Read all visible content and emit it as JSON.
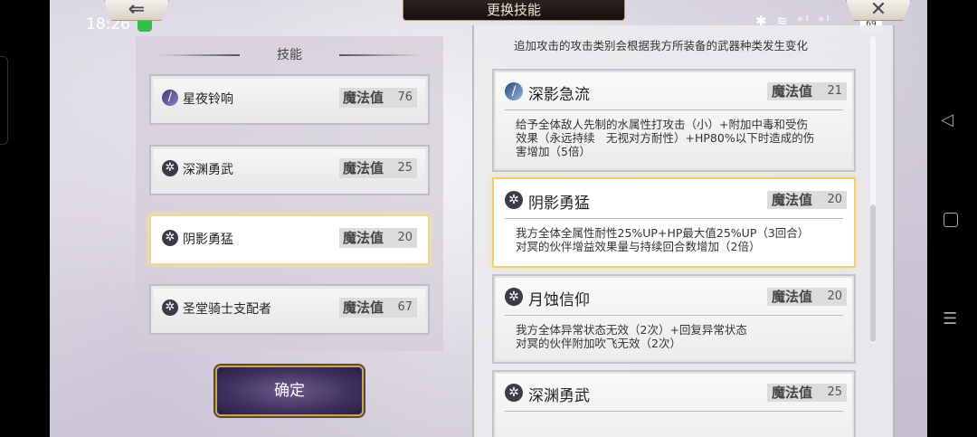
{
  "status": {
    "time": "18:26",
    "icons_right": "✱ ≋ ᵊᴵ ᵊᴵ",
    "battery": "69"
  },
  "title": "更换技能",
  "buttons": {
    "back": "⇐",
    "close": "✕",
    "confirm": "确定"
  },
  "left": {
    "header": "技能",
    "mp_label": "魔法值",
    "items": [
      {
        "name": "星夜铃响",
        "mp": "76",
        "icon": "magic-icon"
      },
      {
        "name": "深渊勇武",
        "mp": "25",
        "icon": "compass-icon"
      },
      {
        "name": "阴影勇猛",
        "mp": "20",
        "icon": "compass-icon"
      },
      {
        "name": "圣堂骑士支配者",
        "mp": "67",
        "icon": "compass-icon"
      }
    ]
  },
  "right": {
    "mp_label": "魔法值",
    "top_desc": "追加攻击的攻击类别会根据我方所装备的武器种类发生变化",
    "cards": [
      {
        "name": "深影急流",
        "mp": "21",
        "desc": "给予全体敌人先制的水属性打攻击（小）+附加中毒和受伤\n效果（永远持续　无视对方耐性）+HP80%以下时造成的伤\n害增加（5倍）"
      },
      {
        "name": "阴影勇猛",
        "mp": "20",
        "desc": "我方全体全属性耐性25%UP+HP最大值25%UP（3回合）\n对冥的伙伴增益效果量与持续回合数增加（2倍）"
      },
      {
        "name": "月蚀信仰",
        "mp": "20",
        "desc": "我方全体异常状态无效（2次）+回复异常状态\n对冥的伙伴附加吹飞无效（2次）"
      },
      {
        "name": "深渊勇武",
        "mp": "25",
        "desc": ""
      }
    ]
  },
  "nav": {
    "back": "◁",
    "menu": "☰"
  }
}
